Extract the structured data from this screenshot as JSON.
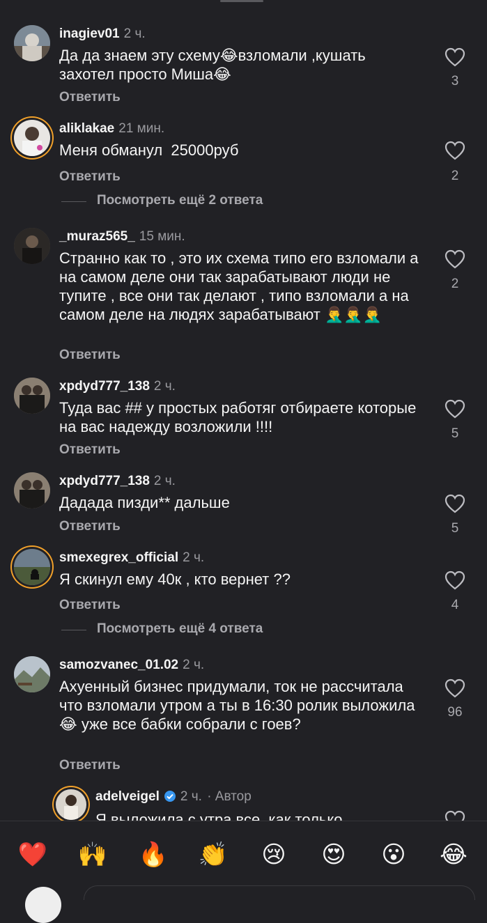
{
  "comments": [
    {
      "username": "inagiev01",
      "time": "2 ч.",
      "text": "Да да знаем эту схему😂взломали ,кушать захотел просто Миша😂",
      "reply": "Ответить",
      "likes": "3"
    },
    {
      "username": "aliklakae",
      "time": "21 мин.",
      "text": "Меня обманул  25000руб",
      "reply": "Ответить",
      "likes": "2",
      "more": "Посмотреть ещё 2 ответа"
    },
    {
      "username": "_muraz565_",
      "time": "15 мин.",
      "text": "Странно как то , это их схема типо его взломали а на самом деле они так зарабатывают люди не тупите , все они так делают , типо взломали а на самом деле на людях зарабатывают 🤦‍♂️🤦‍♂️🤦‍♂️",
      "reply": "Ответить",
      "likes": "2"
    },
    {
      "username": "xpdyd777_138",
      "time": "2 ч.",
      "text": "Туда вас ## у простых работяг отбираете которые на вас надежду возложили !!!!",
      "reply": "Ответить",
      "likes": "5"
    },
    {
      "username": "xpdyd777_138",
      "time": "2 ч.",
      "text": "Дадада пизди** дальше",
      "reply": "Ответить",
      "likes": "5"
    },
    {
      "username": "smexegrex_official",
      "time": "2 ч.",
      "text": "Я скинул ему 40к , кто вернет ??",
      "reply": "Ответить",
      "likes": "4",
      "more": "Посмотреть ещё 4 ответа"
    },
    {
      "username": "samozvanec_01.02",
      "time": "2 ч.",
      "text": "Ахуенный бизнес придумали, ток не рассчитала что взломали утром а ты в 16:30 ролик выложила 😂 уже все бабки собрали с гоев?",
      "reply": "Ответить",
      "likes": "96"
    }
  ],
  "author_reply": {
    "username": "adelveigel",
    "time": "2 ч.",
    "author_label": "· Автор",
    "text": "Я выложила с утра все, как только"
  },
  "reactions": [
    "❤️",
    "🙌",
    "🔥",
    "👏",
    "😢",
    "😍",
    "😮",
    "😂"
  ],
  "colors": {
    "background": "#212125",
    "text": "#f5f5f5",
    "secondary": "#a9a9ae",
    "story_ring": "#f2a12a",
    "verified": "#3897f0"
  }
}
